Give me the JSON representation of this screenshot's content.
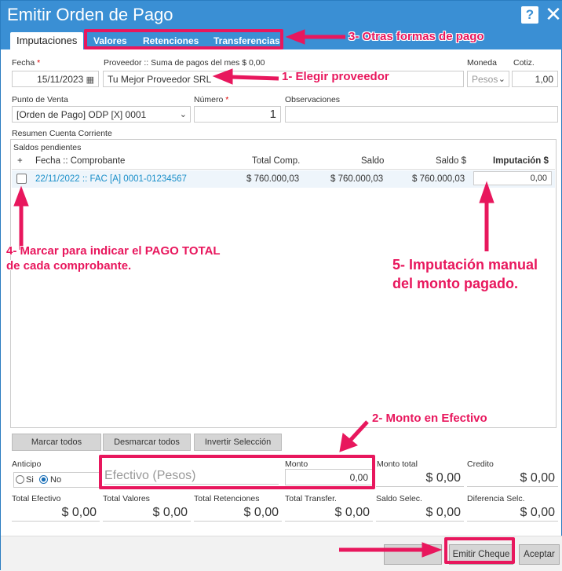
{
  "window": {
    "title": "Emitir Orden de Pago",
    "help_label": "?",
    "close_label": "✕"
  },
  "tabs": {
    "active": "Imputaciones",
    "items": [
      "Valores",
      "Retenciones",
      "Transferencias"
    ]
  },
  "header": {
    "fecha_label": "Fecha",
    "fecha_value": "15/11/2023",
    "proveedor_label": "Proveedor :: Suma de pagos del mes $ 0,00",
    "proveedor_value": "Tu Mejor Proveedor SRL",
    "moneda_label": "Moneda",
    "moneda_value": "Pesos",
    "cotiz_label": "Cotiz.",
    "cotiz_value": "1,00",
    "punto_venta_label": "Punto de Venta",
    "punto_venta_value": "[Orden de Pago] ODP [X] 0001",
    "numero_label": "Número",
    "numero_value": "1",
    "observaciones_label": "Observaciones",
    "observaciones_value": ""
  },
  "resumen": {
    "title": "Resumen Cuenta Corriente",
    "subtitle": "Saldos pendientes",
    "columns": [
      "+",
      "Fecha :: Comprobante",
      "Total Comp.",
      "Saldo",
      "Saldo $",
      "Imputación $"
    ],
    "rows": [
      {
        "comprobante": "22/11/2022 :: FAC [A] 0001-01234567",
        "total": "$ 760.000,03",
        "saldo": "$ 760.000,03",
        "saldo_pesos": "$ 760.000,03",
        "imputacion": "0,00"
      }
    ]
  },
  "actions": {
    "marcar": "Marcar todos",
    "desmarcar": "Desmarcar todos",
    "invertir": "Invertir Selección"
  },
  "payment": {
    "anticipo_label": "Anticipo",
    "si": "Si",
    "no": "No",
    "efectivo_placeholder": "Efectivo (Pesos)",
    "monto_label": "Monto",
    "monto_value": "0,00",
    "monto_total_label": "Monto total",
    "monto_total_value": "$ 0,00",
    "credito_label": "Credito",
    "credito_value": "$ 0,00"
  },
  "totals": [
    {
      "label": "Total Efectivo",
      "value": "$ 0,00"
    },
    {
      "label": "Total Valores",
      "value": "$ 0,00"
    },
    {
      "label": "Total Retenciones",
      "value": "$ 0,00"
    },
    {
      "label": "Total Transfer.",
      "value": "$ 0,00"
    },
    {
      "label": "Saldo Selec.",
      "value": "$ 0,00"
    },
    {
      "label": "Diferencia Selc.",
      "value": "$ 0,00"
    }
  ],
  "footer": {
    "emitir_cheque": "Emitir Cheque",
    "aceptar": "Aceptar"
  },
  "annotations": {
    "a1": "1- Elegir proveedor",
    "a2": "2- Monto en Efectivo",
    "a3": "3- Otras formas de pago",
    "a4_line1": "4- Marcar para indicar el PAGO TOTAL",
    "a4_line2": "de cada comprobante.",
    "a5_line1": "5- Imputación manual",
    "a5_line2": "del monto pagado."
  },
  "colors": {
    "titlebar": "#3a8fd4",
    "annotation": "#e8175d",
    "link": "#1a8fc9"
  }
}
